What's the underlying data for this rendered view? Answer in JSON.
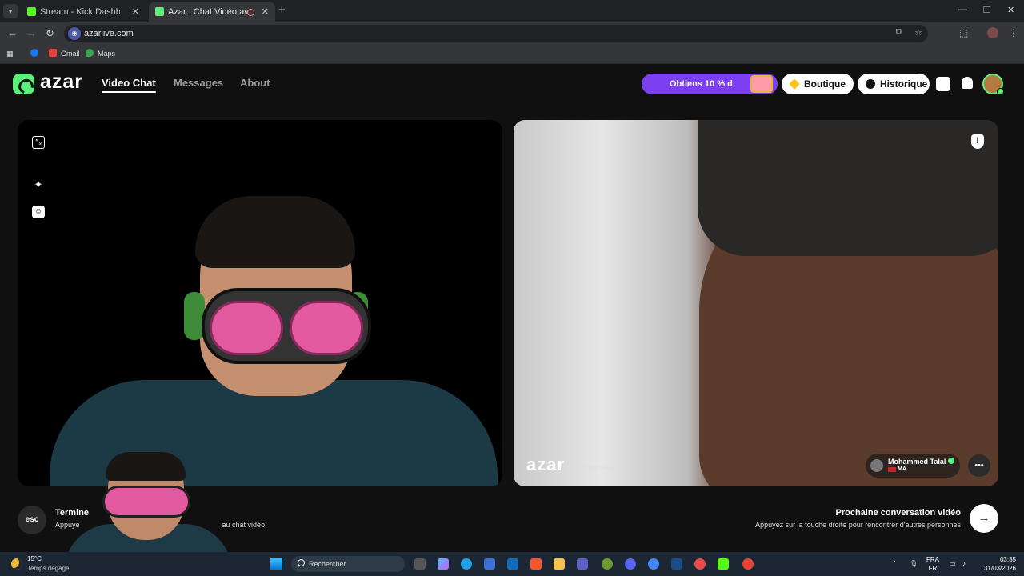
{
  "browser": {
    "tabs": [
      {
        "title": "Stream - Kick Dashboard",
        "favicon_color": "#53fc18"
      },
      {
        "title": "Azar : Chat Vidéo avec de",
        "favicon_color": "#5cf07b"
      }
    ],
    "url": "azarlive.com",
    "bookmarks": [
      {
        "label": "",
        "color": "#1877f2"
      },
      {
        "label": "Gmail",
        "color": "#ea4335"
      },
      {
        "label": "Maps",
        "color": "#34a853"
      }
    ]
  },
  "header": {
    "logo_text": "azar",
    "nav": [
      "Video Chat",
      "Messages",
      "About"
    ],
    "promo_label": "Obtiens 10 % d",
    "shop_label": "Boutique",
    "history_label": "Historique",
    "accent_color": "#5cf07b",
    "promo_color": "#7d3ff2"
  },
  "remote": {
    "watermark": "azar",
    "watermark_id": "ZYV8jUH3uw",
    "user_name": "Mohammed Talal",
    "country_code": "MA"
  },
  "footer": {
    "esc_label": "esc",
    "end_title": "Termine",
    "end_hint_start": "Appuye",
    "end_hint_end": "au chat vidéo.",
    "next_title": "Prochaine conversation vidéo",
    "next_hint": "Appuyez sur la touche droite pour rencontrer d'autres personnes"
  },
  "taskbar": {
    "temperature": "15°C",
    "weather": "Temps dégagé",
    "search_placeholder": "Rechercher",
    "lang_top": "FRA",
    "lang_bottom": "FR",
    "time": "03:35",
    "date": "31/03/2026"
  }
}
